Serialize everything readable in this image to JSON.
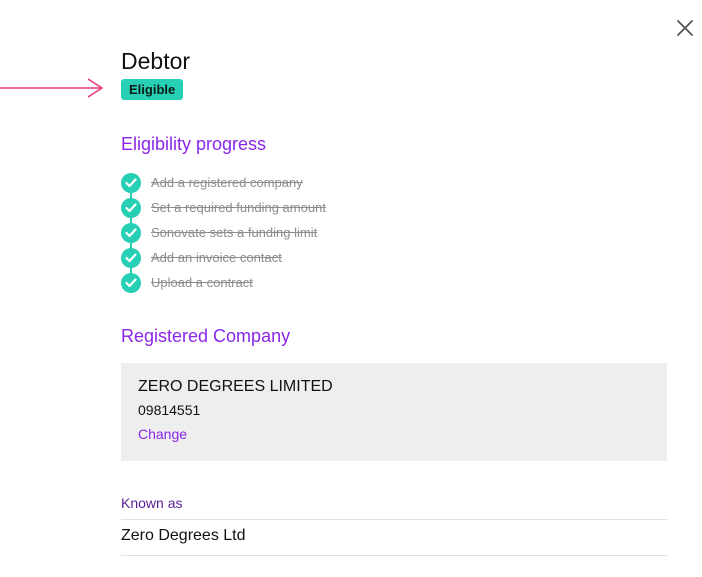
{
  "panel": {
    "title": "Debtor",
    "badge": "Eligible"
  },
  "eligibility": {
    "heading": "Eligibility progress",
    "steps": [
      {
        "label": "Add a registered company",
        "completed": true
      },
      {
        "label": "Set a required funding amount",
        "completed": true
      },
      {
        "label": "Sonovate sets a funding limit",
        "completed": true
      },
      {
        "label": "Add an invoice contact",
        "completed": true
      },
      {
        "label": "Upload a contract",
        "completed": true
      }
    ]
  },
  "registered_company": {
    "heading": "Registered Company",
    "name": "ZERO DEGREES LIMITED",
    "number": "09814551",
    "change_label": "Change"
  },
  "known_as": {
    "label": "Known as",
    "value": "Zero Degrees Ltd"
  },
  "icons": {
    "close": "close-icon",
    "check": "check-icon",
    "pointer": "arrow-right-icon"
  },
  "colors": {
    "accent_purple": "#8a26e8",
    "success_teal": "#27cfb4",
    "pointer_pink": "#e8337a",
    "card_gray": "#eeeeee"
  }
}
